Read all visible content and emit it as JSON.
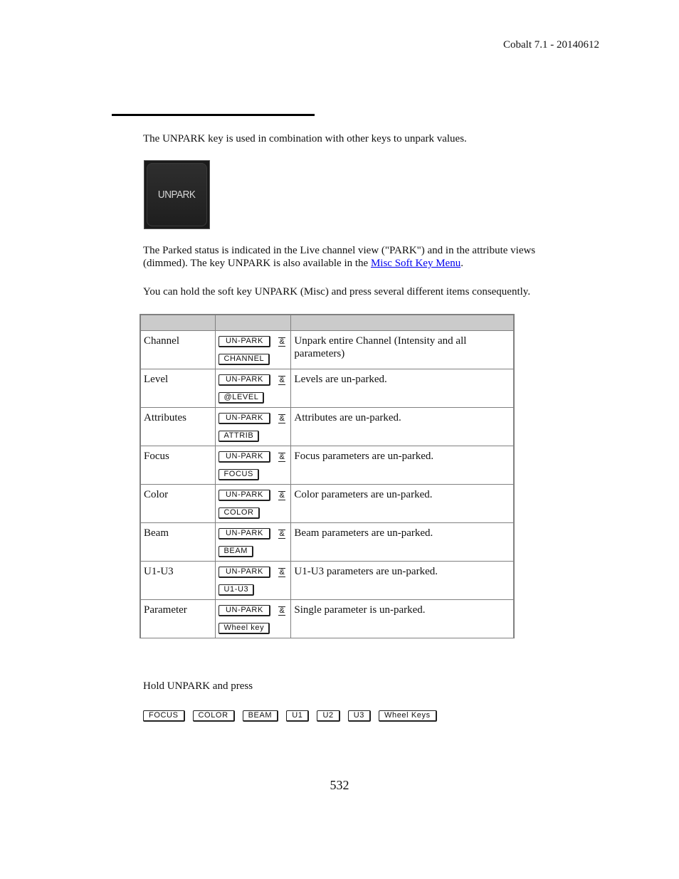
{
  "header": {
    "doc_version": "Cobalt 7.1 - 20140612"
  },
  "intro": "The UNPARK key is used in combination with other keys to unpark values.",
  "key_image": {
    "label": "UNPARK",
    "icon": "unpark-key-image"
  },
  "parked_status": {
    "text_before_link": "The Parked status is indicated in the Live channel view (\"PARK\") and in the attribute views (dimmed). The key UNPARK is also available in the ",
    "link_text": "Misc Soft Key Menu",
    "link_color": "#0000ee",
    "text_after_link": "."
  },
  "hold_soft_key": "You can hold the soft key UNPARK (Misc) and press several different items consequently.",
  "table": {
    "header_fill": "#cbcbcb",
    "headers": [
      "",
      "",
      ""
    ],
    "connector": "&",
    "rows": [
      {
        "item": "Channel",
        "key1": "UN-PARK",
        "key2": "CHANNEL",
        "description": "Unpark entire Channel (Intensity and all parameters)"
      },
      {
        "item": "Level",
        "key1": "UN-PARK",
        "key2": "@LEVEL",
        "description": "Levels are un-parked."
      },
      {
        "item": "Attributes",
        "key1": "UN-PARK",
        "key2": "ATTRIB",
        "description": "Attributes are un-parked."
      },
      {
        "item": "Focus",
        "key1": "UN-PARK",
        "key2": "FOCUS",
        "description": "Focus parameters are un-parked."
      },
      {
        "item": "Color",
        "key1": "UN-PARK",
        "key2": "COLOR",
        "description": "Color parameters are un-parked."
      },
      {
        "item": "Beam",
        "key1": "UN-PARK",
        "key2": "BEAM",
        "description": "Beam parameters are un-parked."
      },
      {
        "item": "U1-U3",
        "key1": "UN-PARK",
        "key2": "U1-U3",
        "description": "U1-U3 parameters are un-parked."
      },
      {
        "item": "Parameter",
        "key1": "UN-PARK",
        "key2": "Wheel key",
        "description": "Single parameter is un-parked."
      }
    ]
  },
  "hold_press": {
    "text": "Hold UNPARK and press",
    "keys": [
      "FOCUS",
      "COLOR",
      "BEAM",
      "U1",
      "U2",
      "U3",
      "Wheel Keys"
    ]
  },
  "footer": {
    "page_number": "532"
  }
}
